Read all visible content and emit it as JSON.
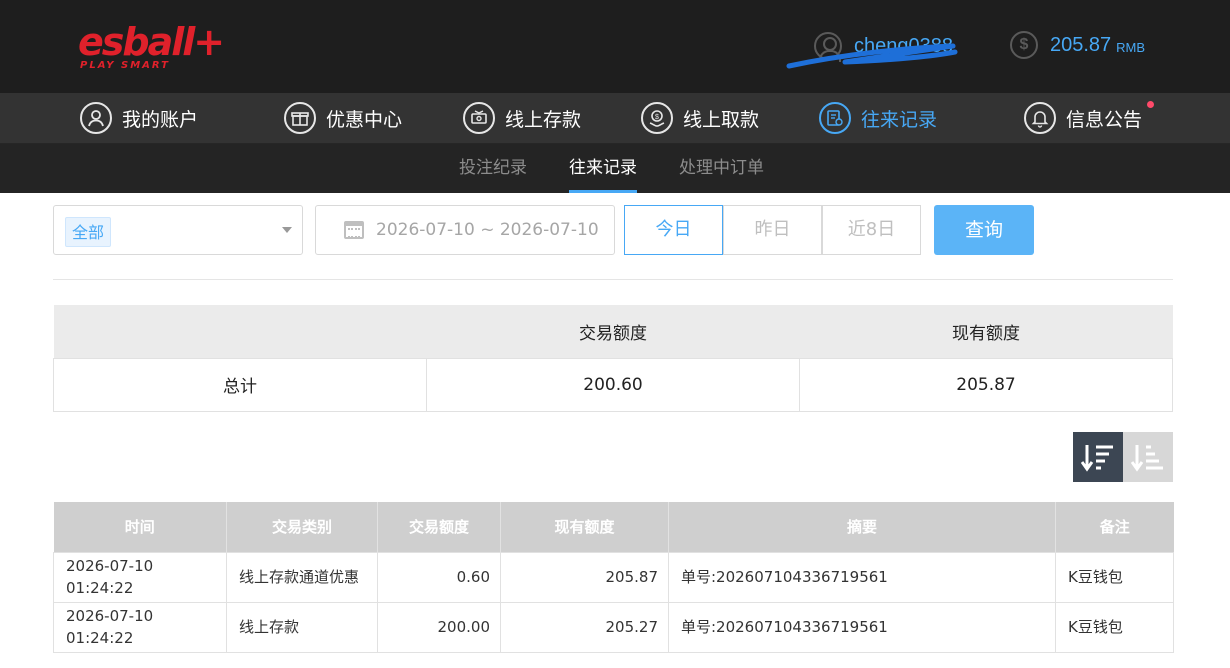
{
  "brand": {
    "logo_text": "esball+",
    "tagline": "PLAY SMART",
    "color": "#e0212b"
  },
  "user": {
    "username": "cheng0388",
    "balance": "205.87",
    "currency": "RMB"
  },
  "nav": [
    {
      "label": "我的账户",
      "icon": "user-circle-icon",
      "active": false
    },
    {
      "label": "优惠中心",
      "icon": "gift-icon",
      "active": false
    },
    {
      "label": "线上存款",
      "icon": "deposit-icon",
      "active": false
    },
    {
      "label": "线上取款",
      "icon": "withdraw-icon",
      "active": false
    },
    {
      "label": "往来记录",
      "icon": "records-icon",
      "active": true
    },
    {
      "label": "信息公告",
      "icon": "bell-icon",
      "active": false,
      "badge_dot": true
    }
  ],
  "subnav": [
    {
      "label": "投注纪录",
      "active": false
    },
    {
      "label": "往来记录",
      "active": true
    },
    {
      "label": "处理中订单",
      "active": false
    }
  ],
  "filters": {
    "type_selected": "全部",
    "date_range": "2026-07-10 ~ 2026-07-10",
    "quick_ranges": [
      "今日",
      "昨日",
      "近8日"
    ],
    "quick_active": "今日",
    "query_label": "查询"
  },
  "summary": {
    "headers": [
      "",
      "交易额度",
      "现有额度"
    ],
    "row_label": "总计",
    "transaction_total": "200.60",
    "current_total": "205.87"
  },
  "table": {
    "headers": [
      "时间",
      "交易类别",
      "交易额度",
      "现有额度",
      "摘要",
      "备注"
    ],
    "rows": [
      [
        "2026-07-10 01:24:22",
        "线上存款通道优惠",
        "0.60",
        "205.87",
        "单号:202607104336719561",
        "K豆钱包"
      ],
      [
        "2026-07-10 01:24:22",
        "线上存款",
        "200.00",
        "205.27",
        "单号:202607104336719561",
        "K豆钱包"
      ]
    ]
  },
  "colors": {
    "accent": "#47a8f5",
    "header_bg": "#1e1e1e",
    "nav_bg": "#333333",
    "notification": "#ff4a6a"
  }
}
